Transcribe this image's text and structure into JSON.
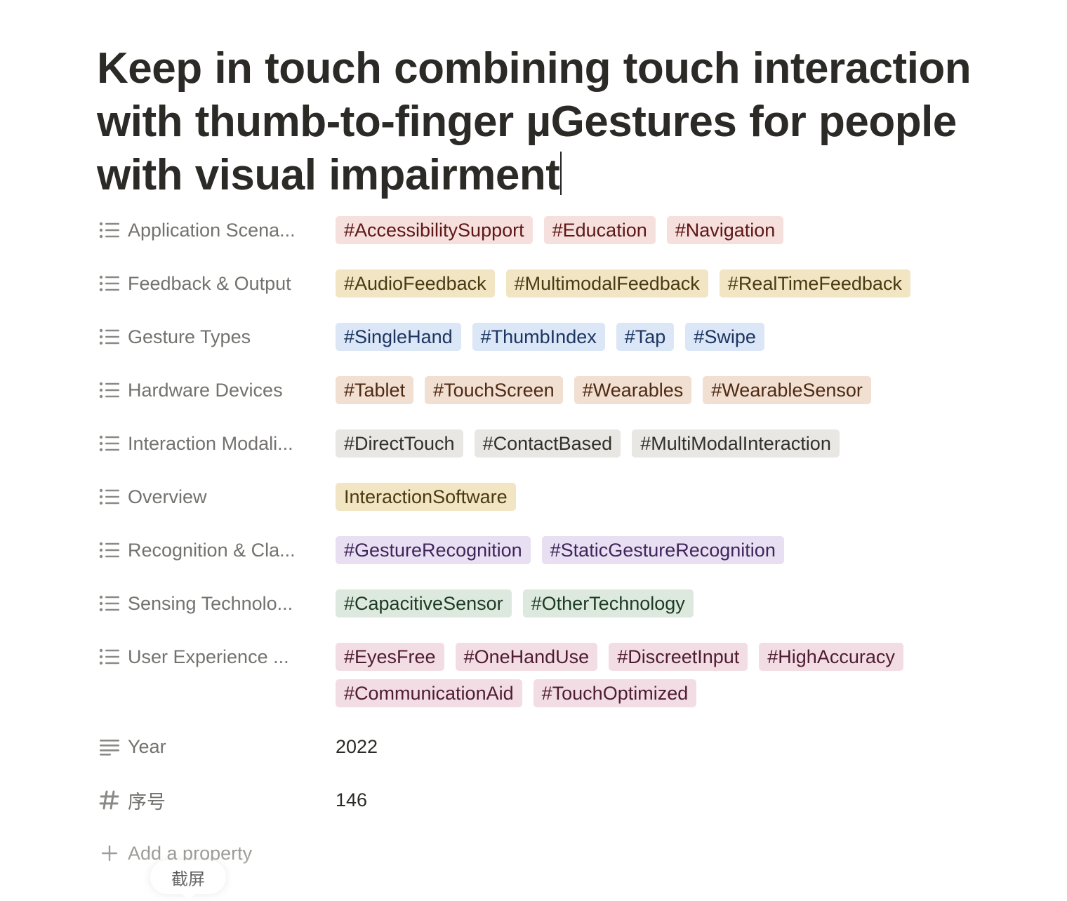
{
  "page": {
    "title": "Keep in touch combining touch interaction with thumb-to-finger µGestures for people with visual impairment"
  },
  "properties": [
    {
      "label": "Application Scena...",
      "icon": "list-icon",
      "tags": [
        {
          "text": "#AccessibilitySupport",
          "color": "red"
        },
        {
          "text": "#Education",
          "color": "red"
        },
        {
          "text": "#Navigation",
          "color": "red"
        }
      ]
    },
    {
      "label": "Feedback & Output",
      "icon": "list-icon",
      "tags": [
        {
          "text": "#AudioFeedback",
          "color": "yellow"
        },
        {
          "text": "#MultimodalFeedback",
          "color": "yellow"
        },
        {
          "text": "#RealTimeFeedback",
          "color": "yellow"
        }
      ]
    },
    {
      "label": "Gesture Types",
      "icon": "list-icon",
      "tags": [
        {
          "text": "#SingleHand",
          "color": "blue"
        },
        {
          "text": "#ThumbIndex",
          "color": "blue"
        },
        {
          "text": "#Tap",
          "color": "blue"
        },
        {
          "text": "#Swipe",
          "color": "blue"
        }
      ]
    },
    {
      "label": "Hardware Devices",
      "icon": "list-icon",
      "tags": [
        {
          "text": "#Tablet",
          "color": "orange"
        },
        {
          "text": "#TouchScreen",
          "color": "orange"
        },
        {
          "text": "#Wearables",
          "color": "orange"
        },
        {
          "text": "#WearableSensor",
          "color": "orange"
        }
      ]
    },
    {
      "label": "Interaction Modali...",
      "icon": "list-icon",
      "tags": [
        {
          "text": "#DirectTouch",
          "color": "gray"
        },
        {
          "text": "#ContactBased",
          "color": "gray"
        },
        {
          "text": "#MultiModalInteraction",
          "color": "gray"
        }
      ]
    },
    {
      "label": "Overview",
      "icon": "list-icon",
      "tags": [
        {
          "text": "InteractionSoftware",
          "color": "yellow"
        }
      ]
    },
    {
      "label": "Recognition & Cla...",
      "icon": "list-icon",
      "tags": [
        {
          "text": "#GestureRecognition",
          "color": "purple"
        },
        {
          "text": "#StaticGestureRecognition",
          "color": "purple"
        }
      ]
    },
    {
      "label": "Sensing Technolo...",
      "icon": "list-icon",
      "tags": [
        {
          "text": "#CapacitiveSensor",
          "color": "green"
        },
        {
          "text": "#OtherTechnology",
          "color": "green"
        }
      ]
    },
    {
      "label": "User Experience ...",
      "icon": "list-icon",
      "tags": [
        {
          "text": "#EyesFree",
          "color": "pink"
        },
        {
          "text": "#OneHandUse",
          "color": "pink"
        },
        {
          "text": "#DiscreetInput",
          "color": "pink"
        },
        {
          "text": "#HighAccuracy",
          "color": "pink"
        },
        {
          "text": "#CommunicationAid",
          "color": "pink"
        },
        {
          "text": "#TouchOptimized",
          "color": "pink"
        }
      ]
    }
  ],
  "text_properties": [
    {
      "label": "Year",
      "icon": "text-lines-icon",
      "value": "2022"
    },
    {
      "label": "序号",
      "icon": "hash-icon",
      "value": "146"
    }
  ],
  "add_property": {
    "label": "Add a property",
    "icon": "plus-icon"
  },
  "tooltip": {
    "label": "截屏"
  }
}
